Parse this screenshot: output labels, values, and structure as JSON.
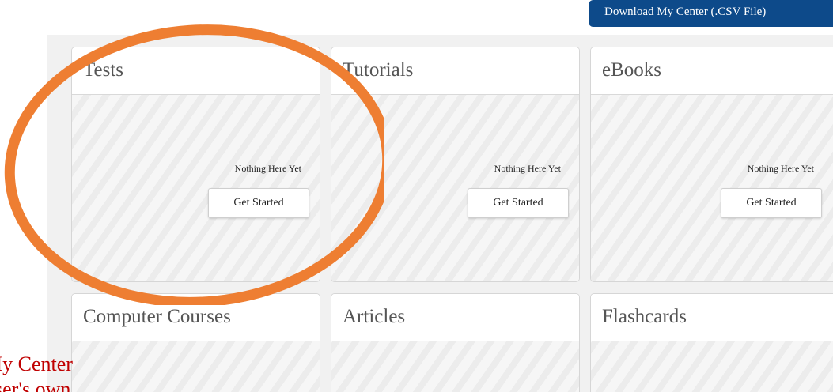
{
  "toolbar": {
    "download_label": "Download My Center (.CSV File)"
  },
  "cards": [
    {
      "title": "Tests",
      "empty_text": "Nothing Here Yet",
      "button_label": "Get Started"
    },
    {
      "title": "Tutorials",
      "empty_text": "Nothing Here Yet",
      "button_label": "Get Started"
    },
    {
      "title": "eBooks",
      "empty_text": "Nothing Here Yet",
      "button_label": "Get Started"
    },
    {
      "title": "Computer Courses"
    },
    {
      "title": "Articles"
    },
    {
      "title": "Flashcards"
    }
  ],
  "annotation": {
    "line1": "My Center page to",
    "line2": "user's own points of",
    "circle_color": "#ee7e32",
    "caption_color": "#c00000"
  },
  "colors": {
    "accent_blue": "#0d4a8a"
  }
}
